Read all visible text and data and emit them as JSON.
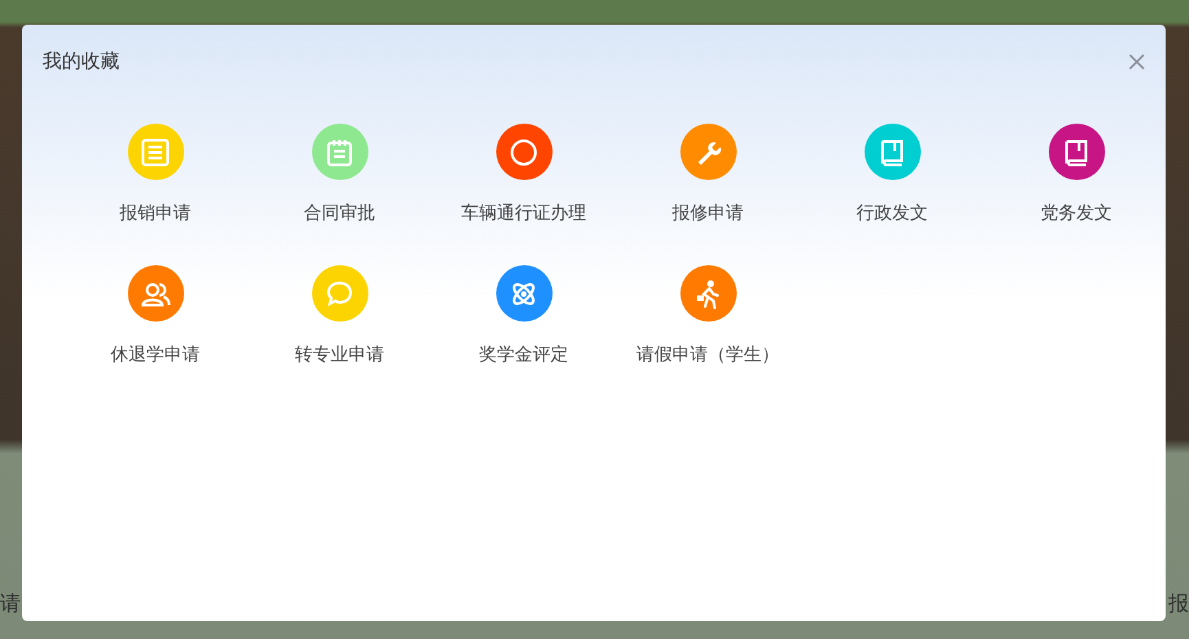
{
  "background": {
    "labels": [
      "请",
      "报"
    ]
  },
  "dialog": {
    "title": "我的收藏",
    "items": [
      {
        "label": "报销申请",
        "color": "#fcd401"
      },
      {
        "label": "合同审批",
        "color": "#8ee88f"
      },
      {
        "label": "车辆通行证办理",
        "color": "#ff4500"
      },
      {
        "label": "报修申请",
        "color": "#ff8c00"
      },
      {
        "label": "行政发文",
        "color": "#00ced1"
      },
      {
        "label": "党务发文",
        "color": "#c71585"
      },
      {
        "label": "休退学申请",
        "color": "#ff7a00"
      },
      {
        "label": "转专业申请",
        "color": "#fcd401"
      },
      {
        "label": "奖学金评定",
        "color": "#1e90ff"
      },
      {
        "label": "请假申请（学生）",
        "color": "#ff7a00"
      }
    ]
  }
}
